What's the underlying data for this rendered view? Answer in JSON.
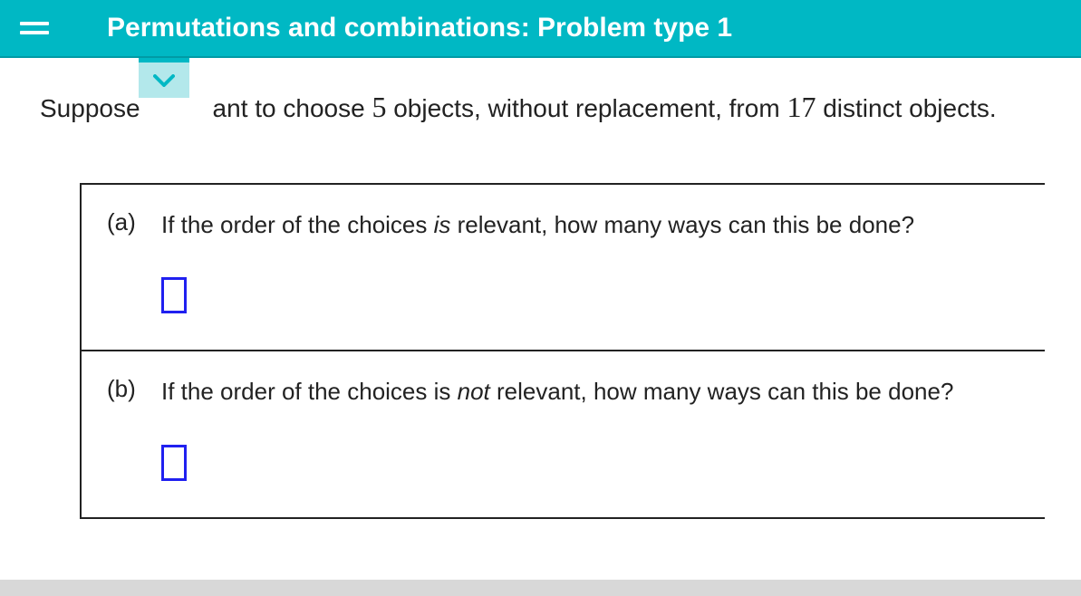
{
  "header": {
    "title": "Permutations and combinations: Problem type 1"
  },
  "problem": {
    "prefix": "Suppose",
    "mid1": "ant to choose ",
    "num1": "5",
    "mid2": " objects, without replacement, from ",
    "num2": "17",
    "suffix": " distinct objects."
  },
  "parts": {
    "a": {
      "label": "(a)",
      "text_before": "If the order of the choices ",
      "text_em": "is",
      "text_after": " relevant, how many ways can this be done?"
    },
    "b": {
      "label": "(b)",
      "text_before": "If the order of the choices is ",
      "text_em": "not",
      "text_after": " relevant, how many ways can this be done?"
    }
  }
}
